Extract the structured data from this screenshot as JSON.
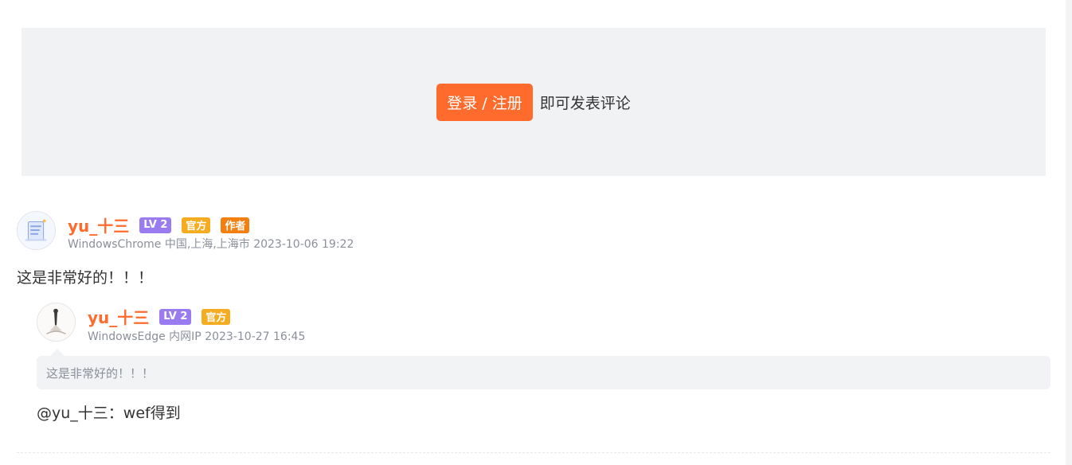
{
  "login": {
    "button_label": "登录 / 注册",
    "tip": "即可发表评论"
  },
  "comments": [
    {
      "username": "yu_十三",
      "badges": {
        "level": "LV 2",
        "official": "官方",
        "author": "作者"
      },
      "info": "WindowsChrome 中国,上海,上海市 2023-10-06 19:22",
      "text": "这是非常好的！！！",
      "avatar_icon": "document-illustration-icon",
      "replies": [
        {
          "username": "yu_十三",
          "badges": {
            "level": "LV 2",
            "official": "官方"
          },
          "info": "WindowsEdge 内网IP 2023-10-27 16:45",
          "quote": "这是非常好的！！！",
          "text": "@yu_十三：wef得到",
          "avatar_icon": "sketch-figure-icon"
        }
      ]
    }
  ],
  "colors": {
    "accent": "#ff6b2c",
    "level_badge": "#9b7cf0",
    "official_badge": "#f5ac20",
    "author_badge": "#f37f10"
  }
}
